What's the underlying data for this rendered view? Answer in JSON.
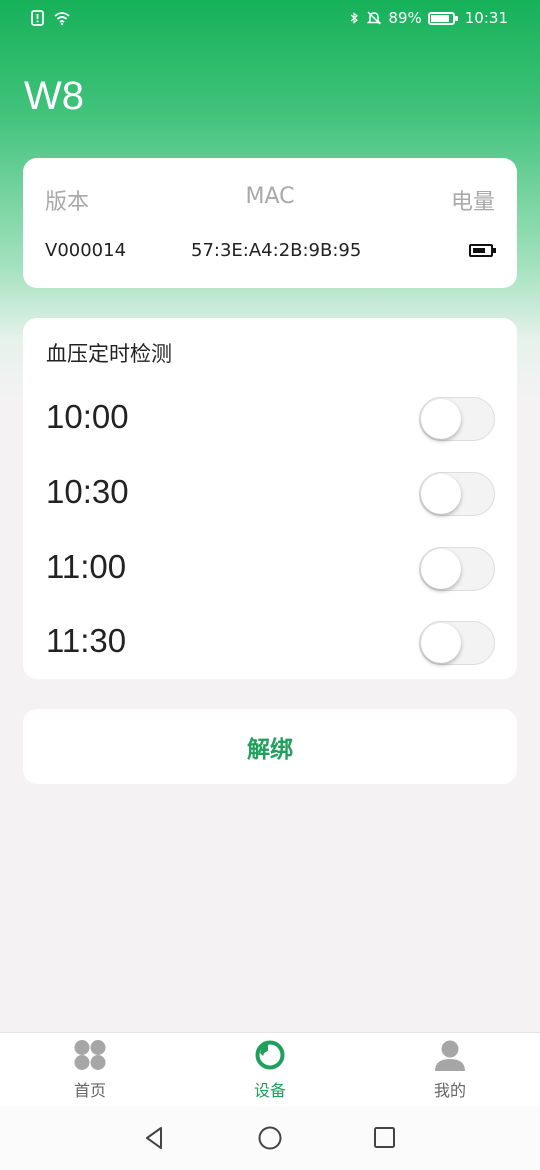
{
  "status_bar": {
    "battery_percent": "89%",
    "time": "10:31",
    "icons": [
      "alert-icon",
      "wifi-icon",
      "bluetooth-icon",
      "mute-icon",
      "battery-icon"
    ]
  },
  "header": {
    "title": "W8"
  },
  "device_info": {
    "headers": {
      "version": "版本",
      "mac": "MAC",
      "power": "电量"
    },
    "values": {
      "version": "V000014",
      "mac": "57:3E:A4:2B:9B:95",
      "battery_level": 0.7
    }
  },
  "bp_schedule": {
    "title": "血压定时检测",
    "items": [
      {
        "time": "10:00",
        "enabled": false
      },
      {
        "time": "10:30",
        "enabled": false
      },
      {
        "time": "11:00",
        "enabled": false
      },
      {
        "time": "11:30",
        "enabled": false
      }
    ]
  },
  "unbind": {
    "label": "解绑"
  },
  "colors": {
    "accent": "#20a05c",
    "header_green": "#16b159",
    "background": "#f4f2f3"
  },
  "tabs": [
    {
      "label": "首页",
      "icon": "home-grid-icon",
      "active": false
    },
    {
      "label": "设备",
      "icon": "device-ring-icon",
      "active": true
    },
    {
      "label": "我的",
      "icon": "person-icon",
      "active": false
    }
  ],
  "nav": {
    "icons": [
      "back-triangle-icon",
      "home-circle-icon",
      "recent-square-icon"
    ]
  }
}
